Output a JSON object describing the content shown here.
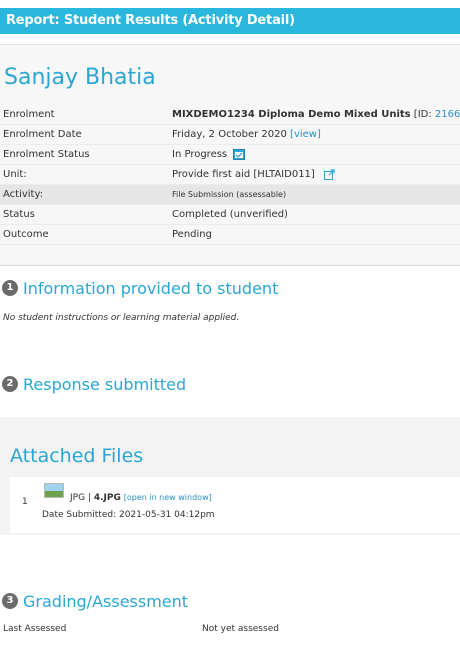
{
  "header": {
    "title": "Report: Student Results (Activity Detail)"
  },
  "student": {
    "name": "Sanjay Bhatia",
    "rows": [
      {
        "label": "Enrolment",
        "value_bold": "MIXDEMO1234 Diploma Demo Mixed Units",
        "value_suffix_pre": " [ID: ",
        "value_link": "2166",
        "value_suffix_post": "]"
      },
      {
        "label": "Enrolment Date",
        "value": "Friday, 2 October 2020",
        "link_pre": " [",
        "link": "view",
        "link_post": "]"
      },
      {
        "label": "Enrolment Status",
        "value": "In Progress"
      },
      {
        "label": "Unit:",
        "value": "Provide first aid [HLTAID011]"
      },
      {
        "label": "Activity:",
        "value": "File Submission (assessable)"
      },
      {
        "label": "Status",
        "value": "Completed (unverified)"
      },
      {
        "label": "Outcome",
        "value": "Pending"
      }
    ]
  },
  "sections": {
    "info": {
      "number": "1",
      "title": "Information provided to student",
      "note": "No student instructions or learning material applied."
    },
    "response": {
      "number": "2",
      "title": "Response submitted"
    },
    "grading": {
      "number": "3",
      "title": "Grading/Assessment"
    }
  },
  "attachments": {
    "title": "Attached Files",
    "files": [
      {
        "index": "1",
        "type": "JPG",
        "separator": " | ",
        "name": "4.JPG",
        "open_link": "[open in new window]",
        "date_label": "Date Submitted: ",
        "date": "2021-05-31 04:12pm",
        "thumb_icon": "image-thumbnail-icon"
      }
    ]
  },
  "grading": {
    "last_assessed_label": "Last Assessed",
    "last_assessed_value": "Not yet assessed"
  },
  "colors": {
    "accent": "#29b7dd",
    "link": "#2a8fc7",
    "title_text": "#29a7d2",
    "badge": "#6b6b6b"
  },
  "icons": {
    "status": "progress-calendar-icon",
    "external": "external-link-icon"
  }
}
